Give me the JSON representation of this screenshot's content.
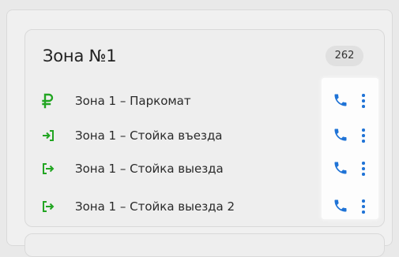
{
  "zone": {
    "title": "Зона №1",
    "count": "262"
  },
  "devices": [
    {
      "icon": "ruble-icon",
      "label": "Зона 1 – Паркомат"
    },
    {
      "icon": "entry-icon",
      "label": "Зона 1 – Стойка въезда"
    },
    {
      "icon": "exit-icon",
      "label": "Зона 1 – Стойка выезда"
    },
    {
      "icon": "exit-icon",
      "label": "Зона 1 – Стойка выезда 2"
    }
  ],
  "colors": {
    "icon_green": "#22a522",
    "action_blue": "#1f73d6"
  },
  "actions": {
    "call_icon": "phone-icon",
    "menu_icon": "kebab-menu-icon"
  }
}
